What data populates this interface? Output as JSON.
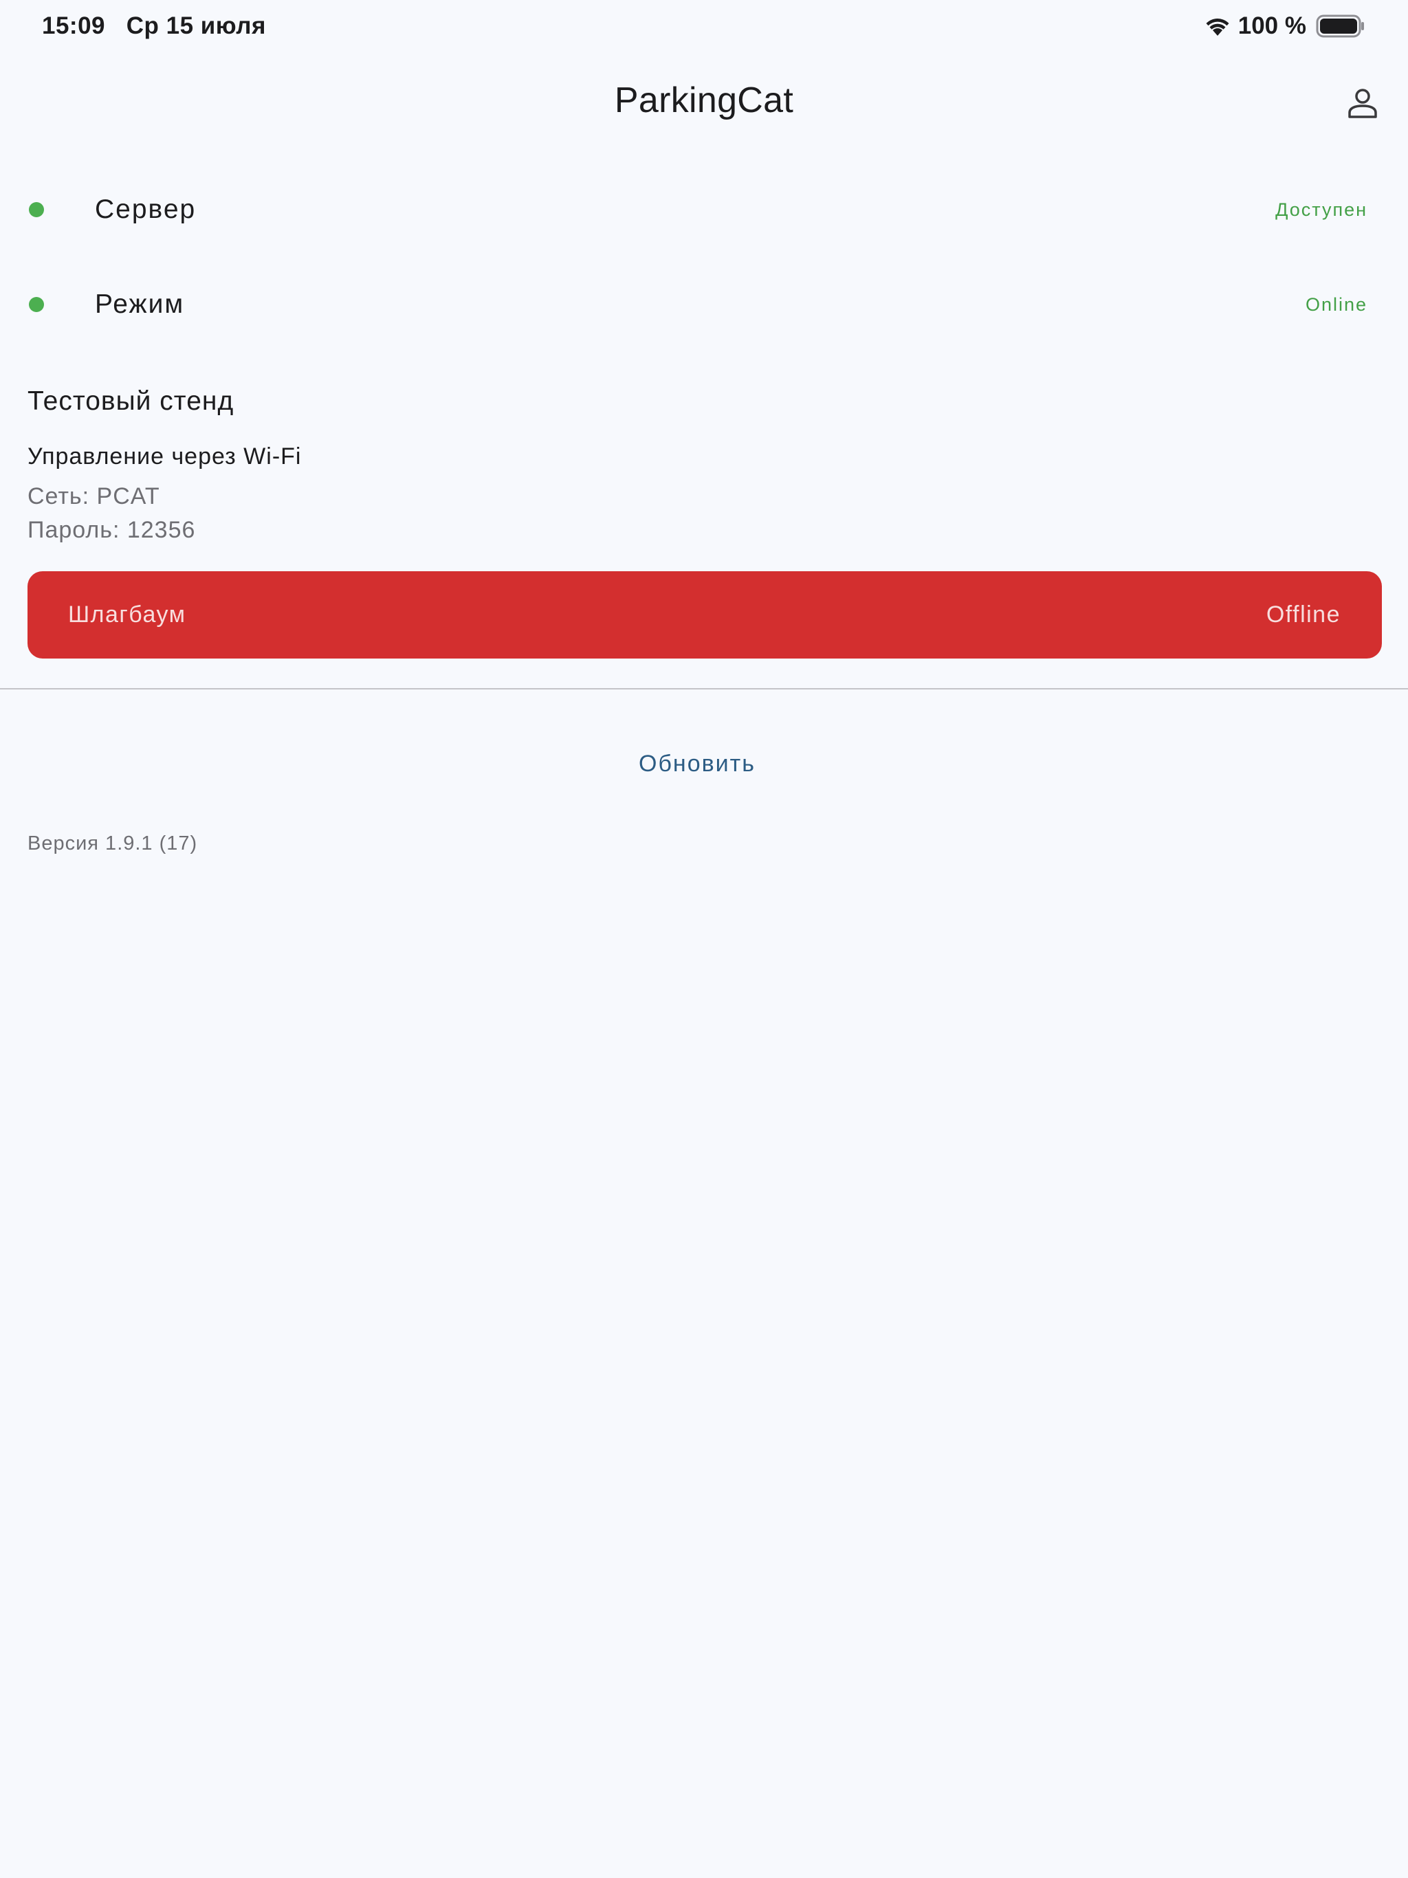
{
  "status_bar": {
    "time": "15:09",
    "date": "Ср 15 июля",
    "battery": "100 %",
    "wifi_icon": "wifi-icon",
    "battery_icon": "battery-icon"
  },
  "header": {
    "title": "ParkingCat",
    "profile_icon": "person-icon"
  },
  "status_rows": [
    {
      "label": "Сервер",
      "value": "Доступен",
      "color": "#4caf50"
    },
    {
      "label": "Режим",
      "value": "Online",
      "color": "#4caf50"
    }
  ],
  "section": {
    "title": "Тестовый стенд",
    "wifi_title": "Управление через Wi-Fi",
    "network": "Сеть: PCAT",
    "password": "Пароль: 12356"
  },
  "barrier": {
    "label": "Шлагбаум",
    "status": "Offline",
    "color": "#d32f2f"
  },
  "actions": {
    "refresh_label": "Обновить"
  },
  "footer": {
    "version": "Версия 1.9.1 (17)"
  }
}
